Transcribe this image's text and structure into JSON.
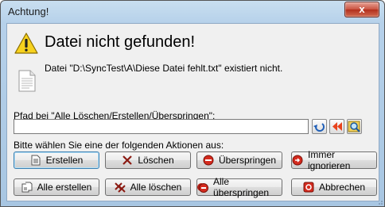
{
  "window": {
    "title": "Achtung!",
    "close_glyph": "x"
  },
  "dialog": {
    "heading": "Datei nicht gefunden!",
    "message": "Datei \"D:\\SyncTest\\A\\Diese Datei fehlt.txt\" existiert nicht.",
    "path_label": "Pfad bei \"Alle Löschen/Erstellen/Überspringen\":",
    "path_value": "",
    "actions_label": "Bitte wählen Sie eine der folgenden Aktionen aus:"
  },
  "buttons": {
    "erstellen": "Erstellen",
    "loeschen": "Löschen",
    "ueberspringen": "Überspringen",
    "immer_ignorieren": "Immer ignorieren",
    "alle_erstellen": "Alle erstellen",
    "alle_loeschen": "Alle löschen",
    "alle_ueberspringen": "Alle überspringen",
    "abbrechen": "Abbrechen"
  },
  "icons": {
    "warning": "warning-icon",
    "file": "file-icon",
    "undo": "undo-icon",
    "rewind": "rewind-icon",
    "browse": "browse-icon"
  },
  "colors": {
    "accent": "#3c7fb1",
    "danger": "#c9231b"
  }
}
